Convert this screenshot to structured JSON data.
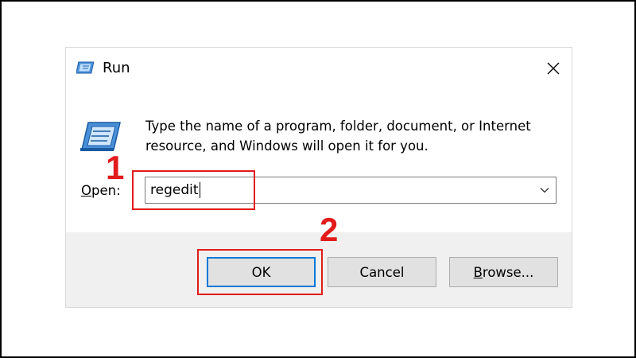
{
  "window": {
    "title": "Run",
    "icon": "run-icon",
    "close_icon": "close-icon"
  },
  "content": {
    "description_line1": "Type the name of a program, folder, document, or Internet",
    "description_line2": "resource, and Windows will open it for you.",
    "open_label_accel": "O",
    "open_label_rest": "pen:",
    "input_value": "regedit"
  },
  "buttons": {
    "ok": "OK",
    "cancel": "Cancel",
    "browse_accel": "B",
    "browse_rest": "rowse..."
  },
  "annotations": {
    "step1": "1",
    "step2": "2",
    "highlight_color": "#e21b1b"
  },
  "colors": {
    "dialog_bg": "#f0f0f0",
    "content_bg": "#ffffff",
    "button_bg": "#e1e1e1",
    "focus_border": "#0078d7"
  }
}
